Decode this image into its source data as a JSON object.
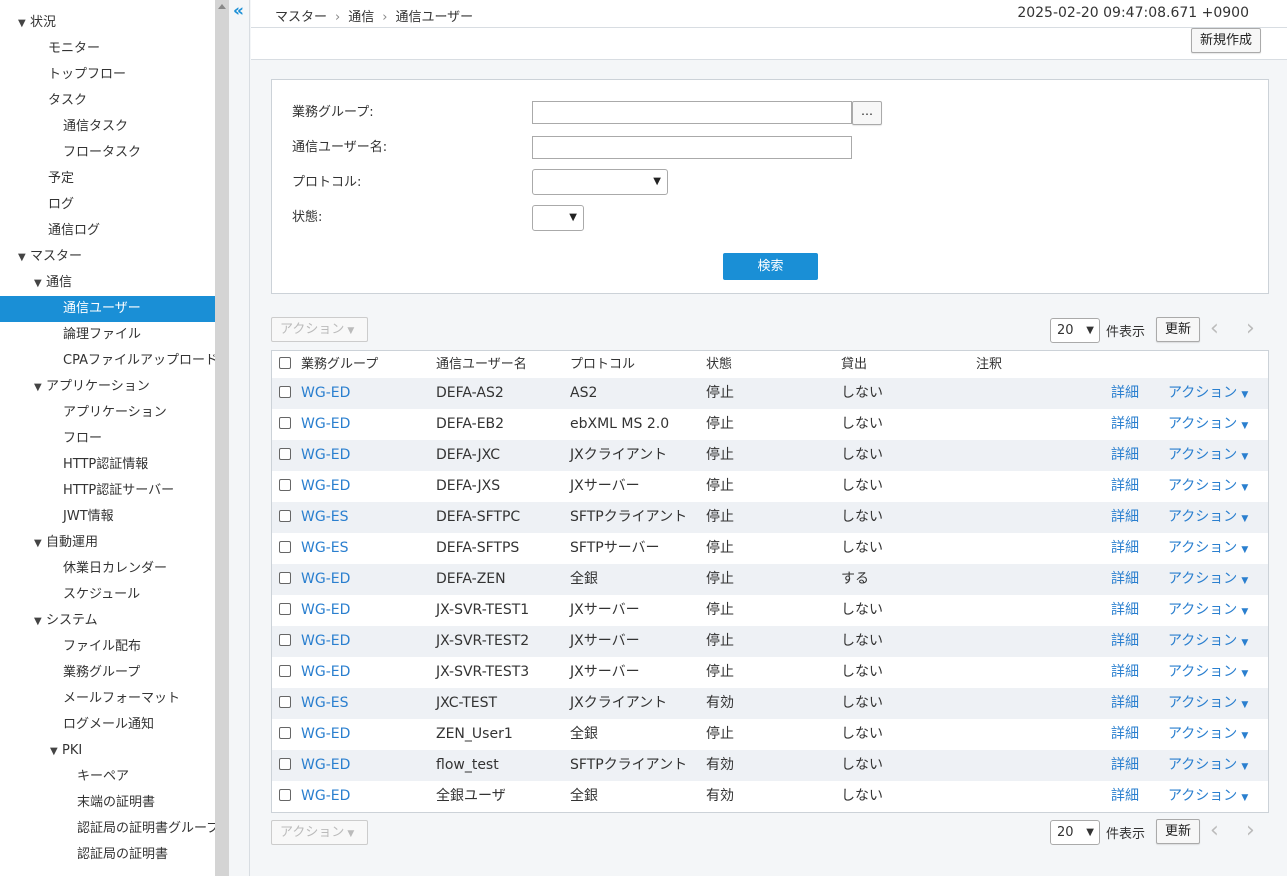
{
  "sidebar": {
    "items": [
      {
        "label": "状況",
        "tri": "▼"
      },
      {
        "label": "モニター"
      },
      {
        "label": "トップフロー"
      },
      {
        "label": "タスク"
      },
      {
        "label": "通信タスク"
      },
      {
        "label": "フロータスク"
      },
      {
        "label": "予定"
      },
      {
        "label": "ログ"
      },
      {
        "label": "通信ログ"
      },
      {
        "label": "マスター",
        "tri": "▼"
      },
      {
        "label": "通信",
        "tri": "▼"
      },
      {
        "label": "通信ユーザー",
        "active": true
      },
      {
        "label": "論理ファイル"
      },
      {
        "label": "CPAファイルアップロード"
      },
      {
        "label": "アプリケーション",
        "tri": "▼"
      },
      {
        "label": "アプリケーション"
      },
      {
        "label": "フロー"
      },
      {
        "label": "HTTP認証情報"
      },
      {
        "label": "HTTP認証サーバー"
      },
      {
        "label": "JWT情報"
      },
      {
        "label": "自動運用",
        "tri": "▼"
      },
      {
        "label": "休業日カレンダー"
      },
      {
        "label": "スケジュール"
      },
      {
        "label": "システム",
        "tri": "▼"
      },
      {
        "label": "ファイル配布"
      },
      {
        "label": "業務グループ"
      },
      {
        "label": "メールフォーマット"
      },
      {
        "label": "ログメール通知"
      },
      {
        "label": "PKI",
        "tri": "▼"
      },
      {
        "label": "キーペア"
      },
      {
        "label": "末端の証明書"
      },
      {
        "label": "認証局の証明書グループ"
      },
      {
        "label": "認証局の証明書"
      }
    ]
  },
  "header": {
    "breadcrumb": [
      "マスター",
      "通信",
      "通信ユーザー"
    ],
    "breadcrumb_sep": "›",
    "datetime": "2025-02-20 09:47:08.671 +0900",
    "new_button": "新規作成",
    "collapse_icon": "«"
  },
  "search": {
    "group_label": "業務グループ:",
    "group_value": "",
    "browse_button": "…",
    "user_label": "通信ユーザー名:",
    "user_value": "",
    "protocol_label": "プロトコル:",
    "protocol_value": "",
    "state_label": "状態:",
    "state_value": "",
    "search_button": "検索"
  },
  "actions": {
    "action_label": "アクション",
    "page_size": "20",
    "per_page_label": "件表示",
    "refresh_label": "更新",
    "prev": "‹",
    "next": "›"
  },
  "table": {
    "headers": [
      "業務グループ",
      "通信ユーザー名",
      "プロトコル",
      "状態",
      "貸出",
      "注釈"
    ],
    "detail_label": "詳細",
    "row_action_label": "アクション",
    "rows": [
      {
        "group": "WG-ED",
        "name": "DEFA-AS2",
        "protocol": "AS2",
        "state": "停止",
        "lend": "しない",
        "note": ""
      },
      {
        "group": "WG-ED",
        "name": "DEFA-EB2",
        "protocol": "ebXML MS 2.0",
        "state": "停止",
        "lend": "しない",
        "note": ""
      },
      {
        "group": "WG-ED",
        "name": "DEFA-JXC",
        "protocol": "JXクライアント",
        "state": "停止",
        "lend": "しない",
        "note": ""
      },
      {
        "group": "WG-ED",
        "name": "DEFA-JXS",
        "protocol": "JXサーバー",
        "state": "停止",
        "lend": "しない",
        "note": ""
      },
      {
        "group": "WG-ES",
        "name": "DEFA-SFTPC",
        "protocol": "SFTPクライアント",
        "state": "停止",
        "lend": "しない",
        "note": ""
      },
      {
        "group": "WG-ES",
        "name": "DEFA-SFTPS",
        "protocol": "SFTPサーバー",
        "state": "停止",
        "lend": "しない",
        "note": ""
      },
      {
        "group": "WG-ED",
        "name": "DEFA-ZEN",
        "protocol": "全銀",
        "state": "停止",
        "lend": "する",
        "note": ""
      },
      {
        "group": "WG-ED",
        "name": "JX-SVR-TEST1",
        "protocol": "JXサーバー",
        "state": "停止",
        "lend": "しない",
        "note": ""
      },
      {
        "group": "WG-ED",
        "name": "JX-SVR-TEST2",
        "protocol": "JXサーバー",
        "state": "停止",
        "lend": "しない",
        "note": ""
      },
      {
        "group": "WG-ED",
        "name": "JX-SVR-TEST3",
        "protocol": "JXサーバー",
        "state": "停止",
        "lend": "しない",
        "note": ""
      },
      {
        "group": "WG-ES",
        "name": "JXC-TEST",
        "protocol": "JXクライアント",
        "state": "有効",
        "lend": "しない",
        "note": ""
      },
      {
        "group": "WG-ED",
        "name": "ZEN_User1",
        "protocol": "全銀",
        "state": "停止",
        "lend": "しない",
        "note": ""
      },
      {
        "group": "WG-ED",
        "name": "flow_test",
        "protocol": "SFTPクライアント",
        "state": "有効",
        "lend": "しない",
        "note": ""
      },
      {
        "group": "WG-ED",
        "name": "全銀ユーザ",
        "protocol": "全銀",
        "state": "有効",
        "lend": "しない",
        "note": ""
      }
    ]
  },
  "colors": {
    "accent": "#1a8fd6",
    "link": "#2a7fcf"
  }
}
